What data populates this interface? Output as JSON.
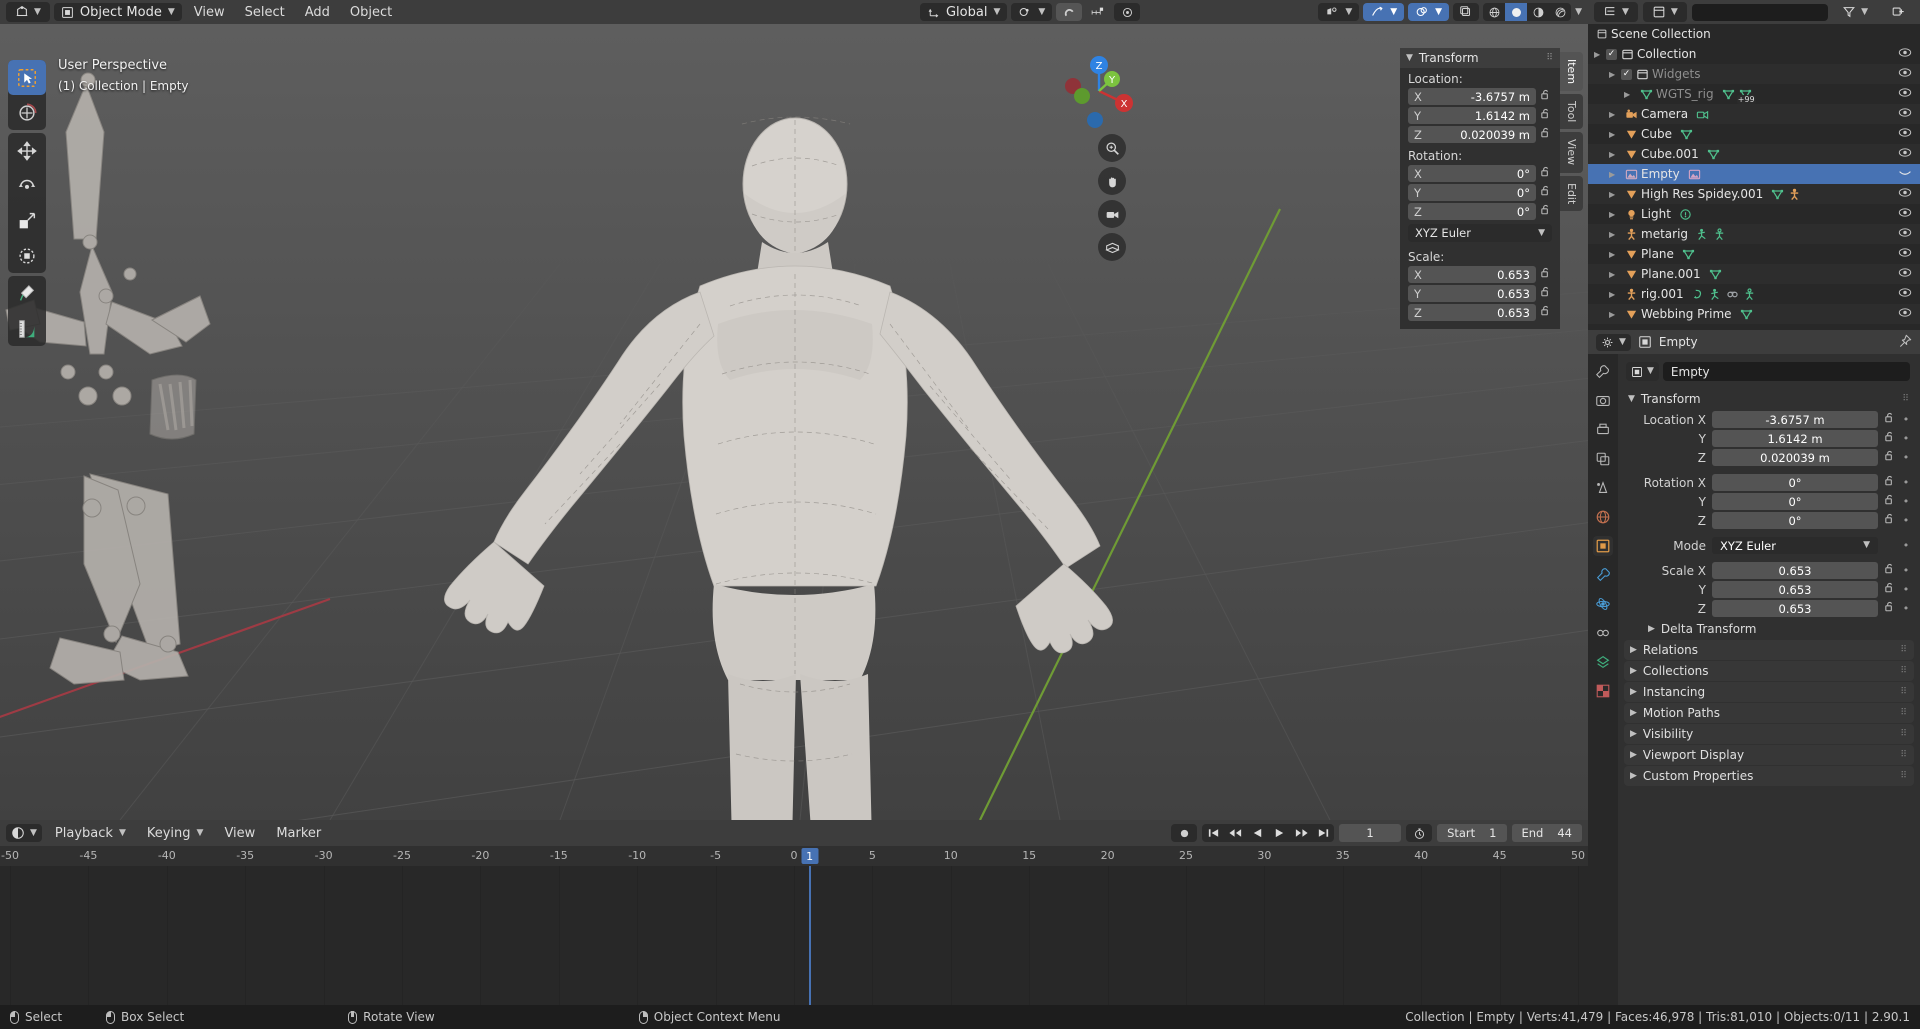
{
  "viewport_header": {
    "editor_icon": "editor-type-3dview-icon",
    "mode": "Object Mode",
    "mode_icon": "object-mode-icon",
    "menus": [
      "View",
      "Select",
      "Add",
      "Object"
    ],
    "transform_orientation": "Global",
    "transform_orientation_icon": "orientation-global-icon",
    "pivot_icon": "pivot-point-icon",
    "snap_magnet_icon": "snap-magnet-icon",
    "snap_target_icon": "snap-increment-icon",
    "proportional_icon": "proportional-editing-icon",
    "visibility_icon": "object-visibility-icon",
    "gizmo_icon": "gizmo-icon",
    "overlays_icon": "overlays-icon",
    "xray_icon": "xray-toggle-icon",
    "shading_modes": [
      "wireframe",
      "solid",
      "material-preview",
      "rendered"
    ],
    "shading_active": "solid"
  },
  "viewport": {
    "perspective_label": "User Perspective",
    "scene_label": "(1) Collection | Empty",
    "tools": [
      {
        "name": "tweak-tool",
        "active": true
      },
      {
        "name": "cursor-tool",
        "active": false
      },
      {
        "name": "move-tool",
        "active": false
      },
      {
        "name": "rotate-tool",
        "active": false
      },
      {
        "name": "scale-tool",
        "active": false
      },
      {
        "name": "transform-tool",
        "active": false
      },
      {
        "name": "annotate-tool",
        "active": false
      },
      {
        "name": "measure-tool",
        "active": false
      }
    ],
    "gizmo_axes": [
      "Z",
      "Y",
      "X"
    ],
    "nav_buttons": [
      "zoom-icon",
      "pan-hand-icon",
      "camera-view-icon",
      "toggle-ortho-icon"
    ]
  },
  "npanel": {
    "tabs": [
      "Item",
      "Tool",
      "View",
      "Edit"
    ],
    "active_tab": "Item",
    "panel_title": "Transform",
    "location_label": "Location:",
    "rotation_label": "Rotation:",
    "scale_label": "Scale:",
    "location": [
      {
        "axis": "X",
        "value": "-3.6757 m"
      },
      {
        "axis": "Y",
        "value": "1.6142 m"
      },
      {
        "axis": "Z",
        "value": "0.020039 m"
      }
    ],
    "rotation": [
      {
        "axis": "X",
        "value": "0°"
      },
      {
        "axis": "Y",
        "value": "0°"
      },
      {
        "axis": "Z",
        "value": "0°"
      }
    ],
    "rotation_mode": "XYZ Euler",
    "scale": [
      {
        "axis": "X",
        "value": "0.653"
      },
      {
        "axis": "Y",
        "value": "0.653"
      },
      {
        "axis": "Z",
        "value": "0.653"
      }
    ]
  },
  "outliner": {
    "header": {
      "editor_icon": "editor-type-outliner-icon",
      "display_mode_icon": "view-layer-icon",
      "filter_icon": "filter-funnel-icon",
      "search_placeholder": ""
    },
    "root": "Scene Collection",
    "rows": [
      {
        "name": "Collection",
        "icon": "collection-icon",
        "indent": 0,
        "checkbox": true,
        "expand": true,
        "dim": false,
        "selected": false,
        "badges": [],
        "eye": true
      },
      {
        "name": "Widgets",
        "icon": "collection-icon",
        "indent": 1,
        "checkbox": true,
        "expand": true,
        "dim": true,
        "selected": false,
        "badges": [],
        "eye": true
      },
      {
        "name": "WGTS_rig",
        "icon": "mesh-data-icon",
        "indent": 2,
        "checkbox": false,
        "expand": true,
        "dim": true,
        "selected": false,
        "badges": [
          "mesh-data-icon",
          "mesh-data-icon-plus99"
        ],
        "eye": true
      },
      {
        "name": "Camera",
        "icon": "camera-icon",
        "indent": 1,
        "checkbox": false,
        "expand": true,
        "dim": false,
        "selected": false,
        "badges": [
          "camera-data-icon"
        ],
        "eye": true
      },
      {
        "name": "Cube",
        "icon": "mesh-icon",
        "indent": 1,
        "checkbox": false,
        "expand": true,
        "dim": false,
        "selected": false,
        "badges": [
          "mesh-data-icon"
        ],
        "eye": true
      },
      {
        "name": "Cube.001",
        "icon": "mesh-icon",
        "indent": 1,
        "checkbox": false,
        "expand": true,
        "dim": false,
        "selected": false,
        "badges": [
          "mesh-data-icon"
        ],
        "eye": true
      },
      {
        "name": "Empty",
        "icon": "image-empty-icon",
        "indent": 1,
        "checkbox": false,
        "expand": true,
        "dim": false,
        "selected": true,
        "badges": [
          "image-data-icon"
        ],
        "eye": false
      },
      {
        "name": "High Res Spidey.001",
        "icon": "mesh-icon",
        "indent": 1,
        "checkbox": false,
        "expand": true,
        "dim": false,
        "selected": false,
        "badges": [
          "mesh-data-icon",
          "armature-modifier-icon"
        ],
        "eye": true
      },
      {
        "name": "Light",
        "icon": "light-icon",
        "indent": 1,
        "checkbox": false,
        "expand": true,
        "dim": false,
        "selected": false,
        "badges": [
          "light-data-icon"
        ],
        "eye": true
      },
      {
        "name": "metarig",
        "icon": "armature-icon",
        "indent": 1,
        "checkbox": false,
        "expand": true,
        "dim": false,
        "selected": false,
        "badges": [
          "pose-icon",
          "armature-data-icon"
        ],
        "eye": true
      },
      {
        "name": "Plane",
        "icon": "mesh-icon",
        "indent": 1,
        "checkbox": false,
        "expand": true,
        "dim": false,
        "selected": false,
        "badges": [
          "mesh-data-icon"
        ],
        "eye": true
      },
      {
        "name": "Plane.001",
        "icon": "mesh-icon",
        "indent": 1,
        "checkbox": false,
        "expand": true,
        "dim": false,
        "selected": false,
        "badges": [
          "mesh-data-icon"
        ],
        "eye": true
      },
      {
        "name": "rig.001",
        "icon": "armature-icon",
        "indent": 1,
        "checkbox": false,
        "expand": true,
        "dim": false,
        "selected": false,
        "badges": [
          "animation-icon",
          "pose-icon",
          "constraint-icon",
          "armature-data-icon"
        ],
        "eye": true
      },
      {
        "name": "Webbing Prime",
        "icon": "mesh-icon",
        "indent": 1,
        "checkbox": false,
        "expand": true,
        "dim": false,
        "selected": false,
        "badges": [
          "mesh-data-icon"
        ],
        "eye": true
      }
    ]
  },
  "properties": {
    "editor_icon": "editor-type-properties-icon",
    "breadcrumb_icon": "object-properties-icon",
    "breadcrumb": "Empty",
    "pin_icon": "pin-icon",
    "id_name": "Empty",
    "tabs": [
      {
        "name": "tool-tab",
        "icon": "tool-icon",
        "active": false
      },
      {
        "name": "render-tab",
        "icon": "camera-back-icon",
        "active": false
      },
      {
        "name": "output-tab",
        "icon": "printer-icon",
        "active": false
      },
      {
        "name": "view-layer-tab",
        "icon": "images-icon",
        "active": false
      },
      {
        "name": "scene-tab",
        "icon": "cone-icon",
        "active": false
      },
      {
        "name": "world-tab",
        "icon": "world-icon",
        "active": false
      },
      {
        "name": "object-tab",
        "icon": "object-square-icon",
        "active": true
      },
      {
        "name": "modifier-tab",
        "icon": "wrench-icon",
        "active": false
      },
      {
        "name": "physics-tab",
        "icon": "physics-icon",
        "active": false
      },
      {
        "name": "constraint-tab",
        "icon": "constraint-icon",
        "active": false
      },
      {
        "name": "data-tab",
        "icon": "object-data-icon",
        "active": false
      },
      {
        "name": "texture-tab",
        "icon": "checker-icon",
        "active": false
      }
    ],
    "transform_title": "Transform",
    "fields": [
      {
        "label": "Location X",
        "value": "-3.6757 m",
        "lock": true
      },
      {
        "label": "Y",
        "value": "1.6142 m",
        "lock": true
      },
      {
        "label": "Z",
        "value": "0.020039 m",
        "lock": true
      },
      {
        "label": "Rotation X",
        "value": "0°",
        "lock": true
      },
      {
        "label": "Y",
        "value": "0°",
        "lock": true
      },
      {
        "label": "Z",
        "value": "0°",
        "lock": true
      },
      {
        "label": "Mode",
        "value": "XYZ Euler",
        "lock": false,
        "dropdown": true
      },
      {
        "label": "Scale X",
        "value": "0.653",
        "lock": true
      },
      {
        "label": "Y",
        "value": "0.653",
        "lock": true
      },
      {
        "label": "Z",
        "value": "0.653",
        "lock": true
      }
    ],
    "subsection": "Delta Transform",
    "sections": [
      "Relations",
      "Collections",
      "Instancing",
      "Motion Paths",
      "Visibility",
      "Viewport Display",
      "Custom Properties"
    ]
  },
  "timeline": {
    "editor_icon": "editor-type-timeline-icon",
    "menus": [
      "Playback",
      "Keying",
      "View",
      "Marker"
    ],
    "menus_with_chevron": [
      "Playback",
      "Keying"
    ],
    "record_icon": "auto-keying-record-icon",
    "transport_icons": [
      "jump-to-start-icon",
      "jump-to-prev-keyframe-icon",
      "play-reverse-icon",
      "play-icon",
      "jump-to-next-keyframe-icon",
      "jump-to-end-icon"
    ],
    "current_frame": "1",
    "frame_indicator_icon": "stopwatch-icon",
    "start_label": "Start",
    "start_value": "1",
    "end_label": "End",
    "end_value": "44",
    "ruler_ticks": [
      "-50",
      "-45",
      "-40",
      "-35",
      "-30",
      "-25",
      "-20",
      "-15",
      "-10",
      "-5",
      "0",
      "5",
      "10",
      "15",
      "20",
      "25",
      "30",
      "35",
      "40",
      "45",
      "50"
    ],
    "playhead_frame": "1"
  },
  "status_bar": {
    "items": [
      {
        "label": "Select",
        "mouse": "left"
      },
      {
        "label": "Box Select",
        "mouse": "left-drag"
      },
      {
        "label": "Rotate View",
        "mouse": "middle"
      },
      {
        "label": "Object Context Menu",
        "mouse": "right"
      }
    ],
    "info": "Collection | Empty | Verts:41,479 | Faces:46,978 | Tris:81,010 | Objects:0/11 | 2.90.1"
  },
  "colors": {
    "accent_blue": "#4772b3",
    "header_gray": "#3d3d3d",
    "panel_gray": "#303030",
    "outliner_gray": "#282828",
    "field_gray": "#545454",
    "axis_x_red": "#cc3333",
    "axis_y_green": "#7cc33f",
    "axis_z_blue": "#2f83e3",
    "mesh_orange": "#e3a05a",
    "data_green": "#4fc08d"
  }
}
